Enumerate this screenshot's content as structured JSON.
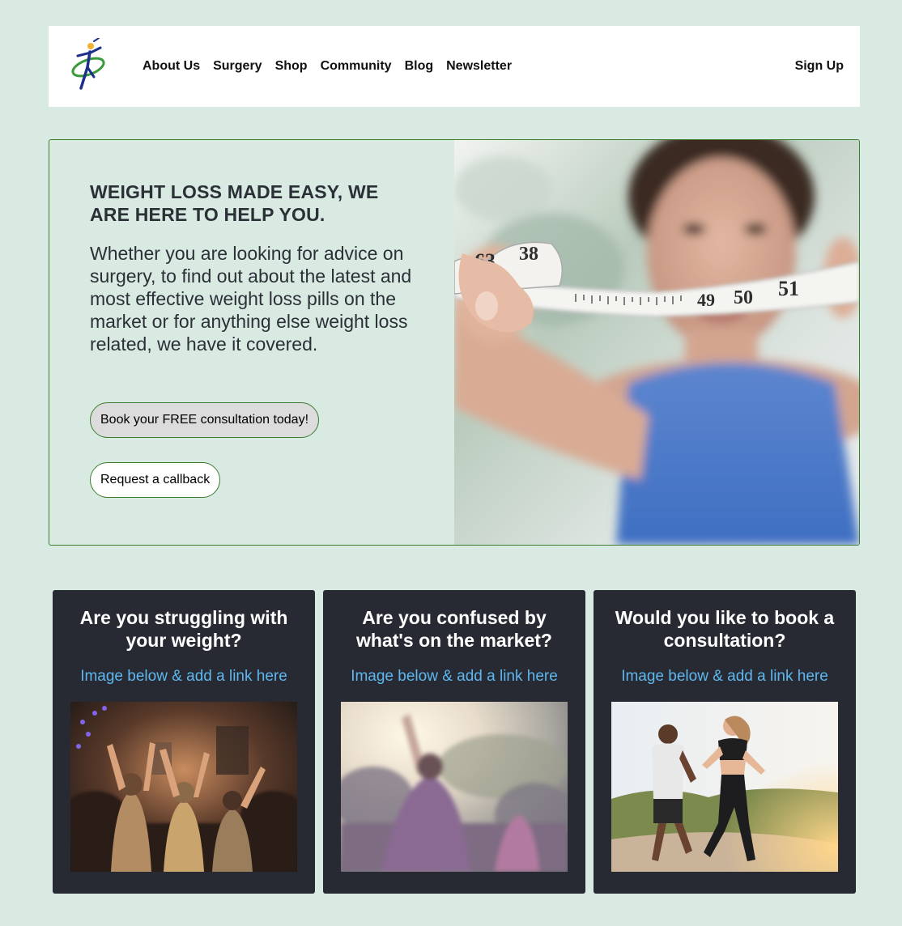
{
  "nav": {
    "logo": "stick-figure-logo",
    "links": [
      "About Us",
      "Surgery",
      "Shop",
      "Community",
      "Blog",
      "Newsletter"
    ],
    "signup": "Sign Up"
  },
  "hero": {
    "title": "WEIGHT LOSS MADE EASY, WE ARE HERE TO HELP YOU.",
    "text": "Whether you are looking for advice on surgery, to find out about the latest and most effective weight loss pills on the market or for anything else weight loss related, we have it covered.",
    "primary_button": "Book your FREE consultation today!",
    "secondary_button": "Request a callback",
    "tape_numbers": [
      "63",
      "38",
      "49",
      "50",
      "51"
    ]
  },
  "cards": [
    {
      "title": "Are you struggling with your weight?",
      "link": "Image below & add a link here"
    },
    {
      "title": "Are you confused by what's on the market?",
      "link": "Image below & add a link here"
    },
    {
      "title": "Would you like to book a consultation?",
      "link": "Image below & add a link here"
    }
  ],
  "colors": {
    "page_bg": "#d9eae3",
    "card_bg": "#272a33",
    "link": "#5fb7ee",
    "border_green": "#3b7d2e"
  }
}
